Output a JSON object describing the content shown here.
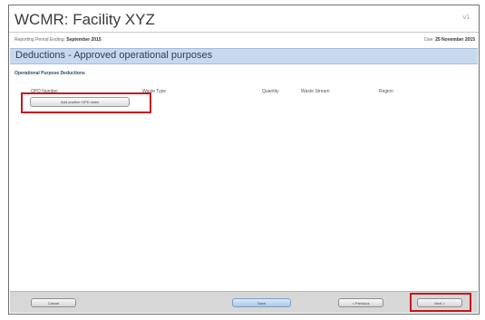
{
  "header": {
    "title": "WCMR: Facility XYZ",
    "version": "v1",
    "reporting_period_label": "Reporting Period Ending:",
    "reporting_period_value": "September 2015",
    "due_label": "Due:",
    "due_value": "25 November 2015"
  },
  "section": {
    "title": "Deductions - Approved operational purposes",
    "subheading": "Operational Purpose Deductions"
  },
  "table": {
    "columns": [
      "OPD Number",
      "Waste Type",
      "Quantity",
      "Waste Stream",
      "Region"
    ]
  },
  "actions": {
    "add_claim_label": "Add another OPD claim"
  },
  "footer": {
    "cancel_label": "Cancel",
    "save_label": "Save",
    "previous_label": "< Previous",
    "next_label": "Next >"
  },
  "colors": {
    "highlight": "#c8161d",
    "section_bar": "#c8d9ee"
  }
}
